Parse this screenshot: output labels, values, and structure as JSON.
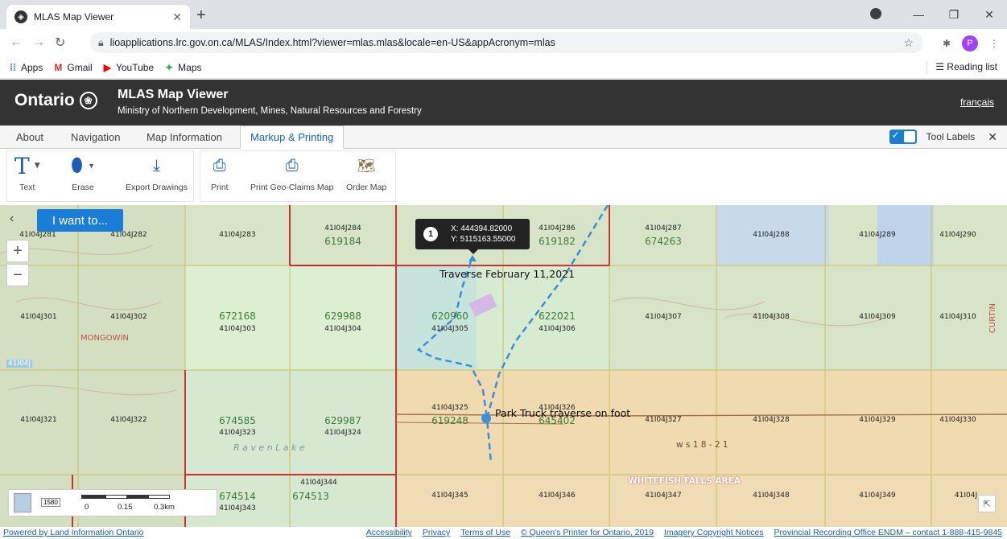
{
  "browser": {
    "tab_title": "MLAS Map Viewer",
    "url": "lioapplications.lrc.gov.on.ca/MLAS/Index.html?viewer=mlas.mlas&locale=en-US&appAcronym=mlas",
    "avatar_letter": "P",
    "bookmarks": [
      {
        "label": "Apps",
        "icon": "apps-grid-icon"
      },
      {
        "label": "Gmail",
        "icon": "gmail-icon"
      },
      {
        "label": "YouTube",
        "icon": "youtube-icon"
      },
      {
        "label": "Maps",
        "icon": "maps-icon"
      }
    ],
    "reading_list": "Reading list"
  },
  "header": {
    "brand": "Ontario",
    "title": "MLAS Map Viewer",
    "subtitle": "Ministry of Northern Development, Mines, Natural Resources and Forestry",
    "language_link": "français"
  },
  "menu": {
    "tabs": [
      "About",
      "Navigation",
      "Map Information",
      "Markup & Printing"
    ],
    "active_tab": "Markup & Printing",
    "tool_labels": "Tool Labels"
  },
  "toolbar": {
    "text": "Text",
    "erase": "Erase",
    "export": "Export Drawings",
    "print": "Print",
    "print_geo": "Print Geo-Claims Map",
    "order_map": "Order Map"
  },
  "map": {
    "i_want_to": "I want to...",
    "coord_marker_number": "1",
    "coord_x": "X: 444394.82000",
    "coord_y": "Y: 5115163.55000",
    "label_traverse": "Traverse February 11,2021",
    "label_park": "Park Truck traverse on foot",
    "label_mongowin": "MONGOWIN",
    "label_whitefish": "WHITEFISH FALLS AREA",
    "label_ws": "w s 1 8 - 2 1",
    "label_raven": "R a v e n   L a k e",
    "label_curtin": "CURTIN",
    "label_41i04j": "41I04J",
    "scale_ratio": "1580",
    "scale_labels": [
      "0",
      "0.15",
      "0.3km"
    ],
    "parcels": [
      {
        "code": "41I04J281",
        "claim": ""
      },
      {
        "code": "41I04J282",
        "claim": ""
      },
      {
        "code": "41I04J283",
        "claim": ""
      },
      {
        "code": "41I04J284",
        "claim": "619184"
      },
      {
        "code": "41I04J286",
        "claim": "619182"
      },
      {
        "code": "41I04J287",
        "claim": "674263"
      },
      {
        "code": "41I04J288",
        "claim": ""
      },
      {
        "code": "41I04J289",
        "claim": ""
      },
      {
        "code": "41I04J290",
        "claim": ""
      },
      {
        "code": "41I04J301",
        "claim": ""
      },
      {
        "code": "41I04J302",
        "claim": ""
      },
      {
        "code": "41I04J303",
        "claim": "672168"
      },
      {
        "code": "41I04J304",
        "claim": "629988"
      },
      {
        "code": "41I04J305",
        "claim": "620960"
      },
      {
        "code": "41I04J306",
        "claim": "622021"
      },
      {
        "code": "41I04J307",
        "claim": ""
      },
      {
        "code": "41I04J308",
        "claim": ""
      },
      {
        "code": "41I04J309",
        "claim": ""
      },
      {
        "code": "41I04J310",
        "claim": ""
      },
      {
        "code": "41I04J321",
        "claim": ""
      },
      {
        "code": "41I04J322",
        "claim": ""
      },
      {
        "code": "41I04J323",
        "claim": "674585"
      },
      {
        "code": "41I04J324",
        "claim": "629987"
      },
      {
        "code": "41I04J325",
        "claim": "619248"
      },
      {
        "code": "41I04J326",
        "claim": "645402"
      },
      {
        "code": "41I04J327",
        "claim": ""
      },
      {
        "code": "41I04J328",
        "claim": ""
      },
      {
        "code": "41I04J329",
        "claim": ""
      },
      {
        "code": "41I04J330",
        "claim": ""
      },
      {
        "code": "41I04J343",
        "claim": "674514"
      },
      {
        "code": "41I04J344",
        "claim": "674513"
      },
      {
        "code": "41I04J345",
        "claim": ""
      },
      {
        "code": "41I04J346",
        "claim": ""
      },
      {
        "code": "41I04J347",
        "claim": ""
      },
      {
        "code": "41I04J348",
        "claim": ""
      },
      {
        "code": "41I04J349",
        "claim": ""
      },
      {
        "code": "41I04J",
        "claim": ""
      }
    ]
  },
  "footer": {
    "powered": "Powered by Land Information Ontario",
    "links": [
      "Accessibility",
      "Privacy",
      "Terms of Use",
      "© Queen's Printer for Ontario, 2019",
      "Imagery Copyright Notices",
      "Provincial Recording Office ENDM – contact 1-888-415-9845"
    ]
  },
  "colors": {
    "header_bg": "#333333",
    "accent": "#1a7dd7",
    "claim_border": "#d0302f",
    "claim_fill": "#f3d7a6",
    "traverse": "#3b8fd9"
  }
}
